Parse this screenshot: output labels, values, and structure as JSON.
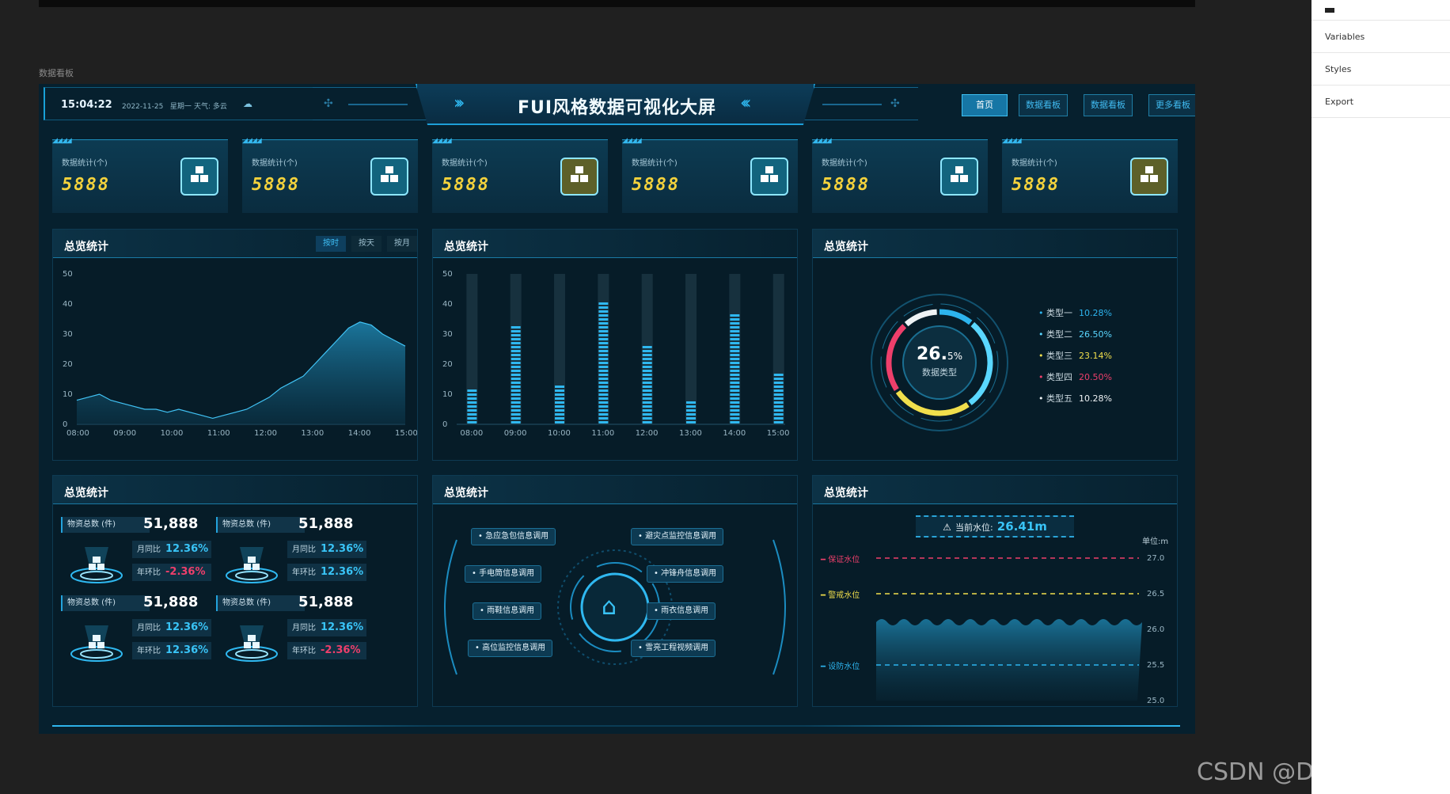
{
  "editor": {
    "items": [
      "Variables",
      "Styles",
      "Export"
    ]
  },
  "board_label": "数据看板",
  "header": {
    "time": "15:04:22",
    "date": "2022-11-25",
    "weekday": "星期一",
    "weather": "天气: 多云",
    "title": "FUI风格数据可视化大屏",
    "nav": [
      "首页",
      "数据看板",
      "数据看板",
      "更多看板"
    ]
  },
  "cards": [
    {
      "label": "数据统计(个)",
      "value": "5888",
      "icon": "boxes-icon",
      "color": "#12647e"
    },
    {
      "label": "数据统计(个)",
      "value": "5888",
      "icon": "boxes-icon",
      "color": "#12647e"
    },
    {
      "label": "数据统计(个)",
      "value": "5888",
      "icon": "boxes-icon",
      "color": "#5d6029"
    },
    {
      "label": "数据统计(个)",
      "value": "5888",
      "icon": "boxes-icon",
      "color": "#12647e"
    },
    {
      "label": "数据统计(个)",
      "value": "5888",
      "icon": "boxes-icon",
      "color": "#12647e"
    },
    {
      "label": "数据统计(个)",
      "value": "5888",
      "icon": "boxes-icon",
      "color": "#5d6029"
    }
  ],
  "panels": {
    "area": {
      "title": "总览统计",
      "tabs": [
        "按时",
        "按天",
        "按月"
      ]
    },
    "bars": {
      "title": "总览统计"
    },
    "donut": {
      "title": "总览统计",
      "center_value": "26.",
      "center_unit": "5%",
      "center_label": "数据类型",
      "legend": [
        {
          "name": "类型一",
          "pct": "10.28%",
          "color": "#2db4ee"
        },
        {
          "name": "类型二",
          "pct": "26.50%",
          "color": "#5ad7ff"
        },
        {
          "name": "类型三",
          "pct": "23.14%",
          "color": "#f1df4c"
        },
        {
          "name": "类型四",
          "pct": "20.50%",
          "color": "#ee3f6b"
        },
        {
          "name": "类型五",
          "pct": "10.28%",
          "color": "#eef2f4"
        }
      ]
    },
    "materials": {
      "title": "总览统计",
      "blocks": [
        {
          "label": "物资总数 (件)",
          "value": "51,888",
          "mom_label": "月同比",
          "mom": "12.36%",
          "yoy_label": "年环比",
          "yoy": "-2.36%"
        },
        {
          "label": "物资总数 (件)",
          "value": "51,888",
          "mom_label": "月同比",
          "mom": "12.36%",
          "yoy_label": "年环比",
          "yoy": "12.36%"
        },
        {
          "label": "物资总数 (件)",
          "value": "51,888",
          "mom_label": "月同比",
          "mom": "12.36%",
          "yoy_label": "年环比",
          "yoy": "12.36%"
        },
        {
          "label": "物资总数 (件)",
          "value": "51,888",
          "mom_label": "月同比",
          "mom": "12.36%",
          "yoy_label": "年环比",
          "yoy": "-2.36%"
        }
      ]
    },
    "dispatch": {
      "title": "总览统计",
      "left_tags": [
        "急应急包信息调用",
        "手电筒信息调用",
        "雨鞋信息调用",
        "高位监控信息调用"
      ],
      "right_tags": [
        "避灾点监控信息调用",
        "冲锋舟信息调用",
        "雨衣信息调用",
        "雪亮工程视频调用"
      ]
    },
    "water": {
      "title": "总览统计",
      "current_label": "当前水位:",
      "current_value": "26.41m",
      "unit": "单位:m",
      "lines": [
        {
          "name": "保证水位",
          "value": 27.0,
          "color": "#ee3f6b"
        },
        {
          "name": "警戒水位",
          "value": 26.5,
          "color": "#f1df4c"
        },
        {
          "name": "设防水位",
          "value": 25.5,
          "color": "#2db4ee"
        }
      ],
      "ticks": [
        "27.0",
        "26.5",
        "26.0",
        "25.5",
        "25.0"
      ]
    }
  },
  "chart_data": [
    {
      "type": "area",
      "x_ticks": [
        "08:00",
        "09:00",
        "10:00",
        "11:00",
        "12:00",
        "13:00",
        "14:00",
        "15:00"
      ],
      "y_ticks": [
        "0",
        "10",
        "20",
        "30",
        "40",
        "50"
      ],
      "ylim": [
        0,
        50
      ],
      "x": [
        "08:00",
        "08:15",
        "08:30",
        "08:45",
        "09:00",
        "09:15",
        "09:30",
        "09:45",
        "10:00",
        "10:15",
        "10:30",
        "10:45",
        "11:00",
        "11:15",
        "11:30",
        "11:45",
        "12:00",
        "12:15",
        "12:30",
        "12:45",
        "13:00",
        "13:15",
        "13:30",
        "13:45",
        "14:00",
        "14:15",
        "14:30",
        "14:45",
        "15:00",
        "15:15"
      ],
      "values": [
        8,
        9,
        10,
        8,
        7,
        6,
        5,
        5,
        4,
        5,
        4,
        3,
        2,
        3,
        4,
        5,
        7,
        9,
        12,
        14,
        16,
        20,
        24,
        28,
        32,
        34,
        33,
        30,
        28,
        26
      ]
    },
    {
      "type": "bar",
      "categories": [
        "08:00",
        "09:00",
        "10:00",
        "11:00",
        "12:00",
        "13:00",
        "14:00",
        "15:00"
      ],
      "values": [
        12,
        33,
        13,
        41,
        27,
        8,
        37,
        18
      ],
      "y_ticks": [
        "0",
        "10",
        "20",
        "30",
        "40",
        "50"
      ],
      "ylim": [
        0,
        50
      ],
      "color": "#2fb8f0"
    },
    {
      "type": "pie",
      "categories": [
        "类型一",
        "类型二",
        "类型三",
        "类型四",
        "类型五"
      ],
      "values": [
        10.28,
        26.5,
        23.14,
        20.5,
        10.28
      ]
    }
  ]
}
